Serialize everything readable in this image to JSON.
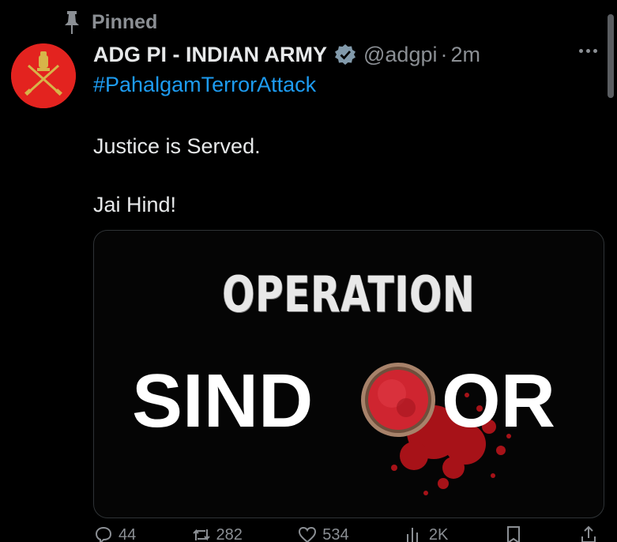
{
  "pinned_label": "Pinned",
  "author": {
    "name": "ADG PI - INDIAN ARMY",
    "handle": "@adgpi",
    "separator": "·",
    "time": "2m"
  },
  "hashtag": "#PahalgamTerrorAttack",
  "body": {
    "line1": "Justice is Served.",
    "line2": "Jai Hind!"
  },
  "media": {
    "title": "OPERATION",
    "word_left": "SIND",
    "word_right": "OR",
    "icon": "sindoor-bowl"
  },
  "actions": {
    "reply_count": "44",
    "repost_count": "282",
    "like_count": "534",
    "views_count": "2K"
  },
  "colors": {
    "background": "#000000",
    "hashtag": "#1d9bf0",
    "muted": "#8b8f94",
    "avatar": "#e3231f",
    "verified": "#829aab",
    "sindoor": "#c4151c"
  }
}
